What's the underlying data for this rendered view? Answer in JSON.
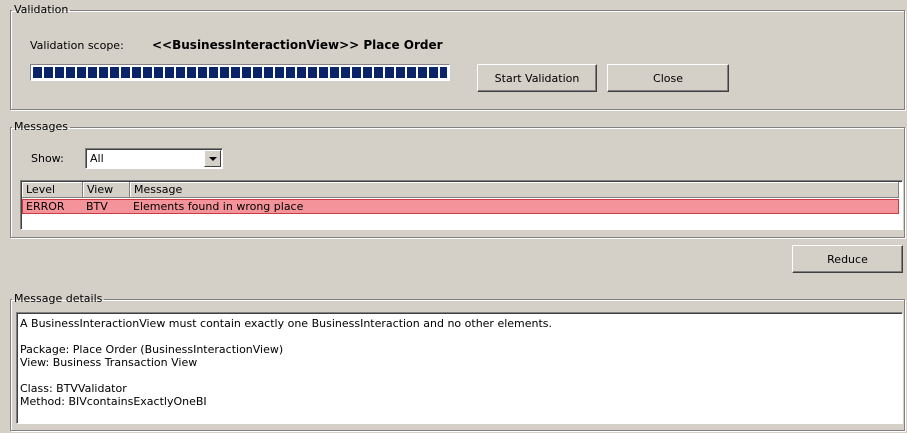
{
  "validation": {
    "legend": "Validation",
    "scope_label": "Validation scope:",
    "scope_value": "<<BusinessInteractionView>> Place Order",
    "progress": 1.0,
    "start_button": "Start Validation",
    "close_button": "Close"
  },
  "messages": {
    "legend": "Messages",
    "show_label": "Show:",
    "show_selected": "All",
    "columns": [
      "Level",
      "View",
      "Message"
    ],
    "rows": [
      {
        "level": "ERROR",
        "view": "BTV",
        "message": "Elements found in wrong place"
      }
    ]
  },
  "reduce_button": "Reduce",
  "details": {
    "legend": "Message details",
    "text": "A BusinessInteractionView must contain exactly one BusinessInteraction and no other elements.\n\nPackage: Place Order (BusinessInteractionView)\nView: Business Transaction View\n\nClass: BTVValidator\nMethod: BIVcontainsExactlyOneBI"
  },
  "colors": {
    "background": "#d4d0c8",
    "progress_fill": "#0a246a",
    "error_row": "#f4949a"
  }
}
